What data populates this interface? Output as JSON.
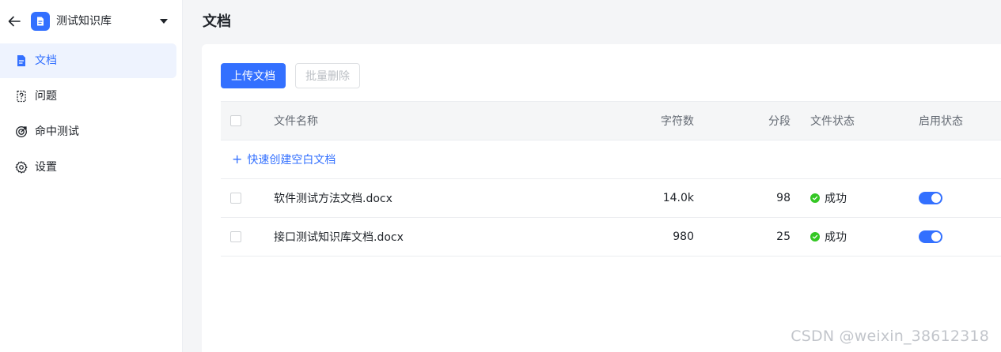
{
  "sidebar": {
    "kb_name": "测试知识库",
    "items": [
      {
        "label": "文档",
        "icon": "document-icon",
        "active": true
      },
      {
        "label": "问题",
        "icon": "question-icon",
        "active": false
      },
      {
        "label": "命中测试",
        "icon": "target-icon",
        "active": false
      },
      {
        "label": "设置",
        "icon": "gear-icon",
        "active": false
      }
    ]
  },
  "main": {
    "title": "文档",
    "upload_label": "上传文档",
    "batch_delete_label": "批量删除",
    "table": {
      "headers": {
        "name": "文件名称",
        "chars": "字符数",
        "segments": "分段",
        "file_status": "文件状态",
        "enable_status": "启用状态"
      },
      "quick_create_label": "快速创建空白文档",
      "rows": [
        {
          "name": "软件测试方法文档.docx",
          "chars": "14.0k",
          "segments": "98",
          "file_status": "成功",
          "enabled": true
        },
        {
          "name": "接口测试知识库文档.docx",
          "chars": "980",
          "segments": "25",
          "file_status": "成功",
          "enabled": true
        }
      ]
    }
  },
  "watermark": "CSDN @weixin_38612318",
  "colors": {
    "accent": "#3370ff",
    "success": "#34c724",
    "active_bg": "#eef3fe"
  }
}
